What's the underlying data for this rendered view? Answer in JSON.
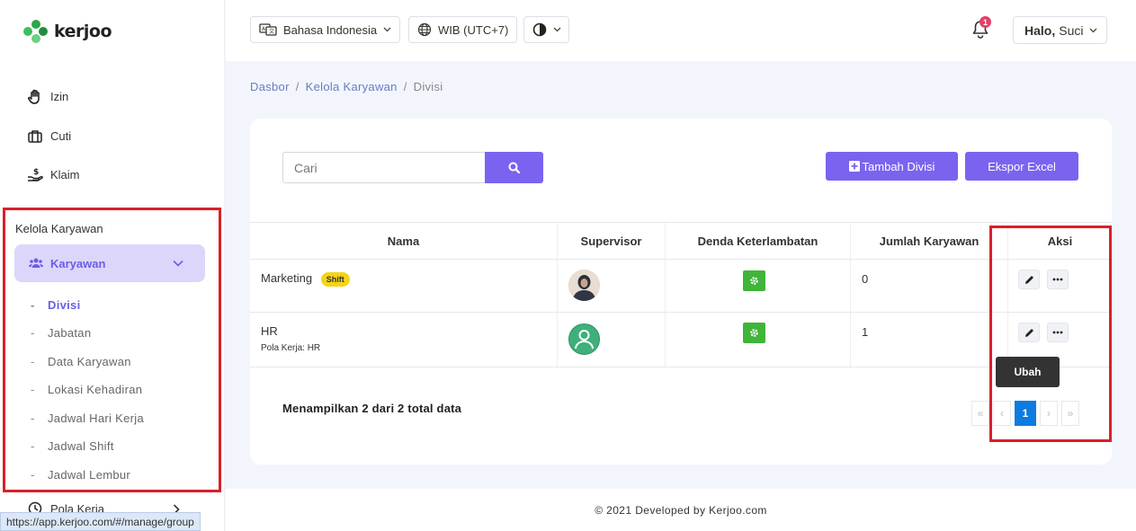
{
  "brand": {
    "name": "kerjoo"
  },
  "sidebar": {
    "items": [
      {
        "label": "Izin",
        "icon": "hand-icon"
      },
      {
        "label": "Cuti",
        "icon": "briefcase-icon"
      },
      {
        "label": "Klaim",
        "icon": "money-hand-icon"
      }
    ],
    "section_title": "Kelola Karyawan",
    "group": {
      "label": "Karyawan",
      "icon": "users-icon"
    },
    "sub_items": [
      {
        "label": "Divisi",
        "active": true
      },
      {
        "label": "Jabatan"
      },
      {
        "label": "Data Karyawan"
      },
      {
        "label": "Lokasi Kehadiran"
      },
      {
        "label": "Jadwal Hari Kerja"
      },
      {
        "label": "Jadwal Shift"
      },
      {
        "label": "Jadwal Lembur"
      }
    ],
    "next_item": {
      "label": "Pola Kerja",
      "icon": "clock-icon"
    }
  },
  "status_url": "https://app.kerjoo.com/#/manage/group",
  "header": {
    "language": "Bahasa Indonesia",
    "timezone": "WIB (UTC+7)",
    "notification_count": "1",
    "greeting_bold": "Halo,",
    "greeting_name": "Suci"
  },
  "breadcrumb": {
    "items": [
      "Dasbor",
      "Kelola Karyawan"
    ],
    "current": "Divisi"
  },
  "toolbar": {
    "search_placeholder": "Cari",
    "add_label": "Tambah Divisi",
    "export_label": "Ekspor Excel"
  },
  "table": {
    "headers": [
      "Nama",
      "Supervisor",
      "Denda Keterlambatan",
      "Jumlah Karyawan",
      "Aksi"
    ],
    "rows": [
      {
        "name": "Marketing",
        "badge": "Shift",
        "note": "",
        "count": "0"
      },
      {
        "name": "HR",
        "badge": "",
        "note": "Pola Kerja: HR",
        "count": "1"
      }
    ]
  },
  "tooltip": "Ubah",
  "summary": "Menampilkan 2 dari 2 total data",
  "pagination": {
    "first": "«",
    "prev": "‹",
    "current": "1",
    "next": "›",
    "last": "»"
  },
  "footer": "© 2021 Developed by Kerjoo.com",
  "colors": {
    "accent": "#7b63f0",
    "highlight": "#d8202a",
    "success": "#3fb53a",
    "badge": "#f6d416"
  }
}
